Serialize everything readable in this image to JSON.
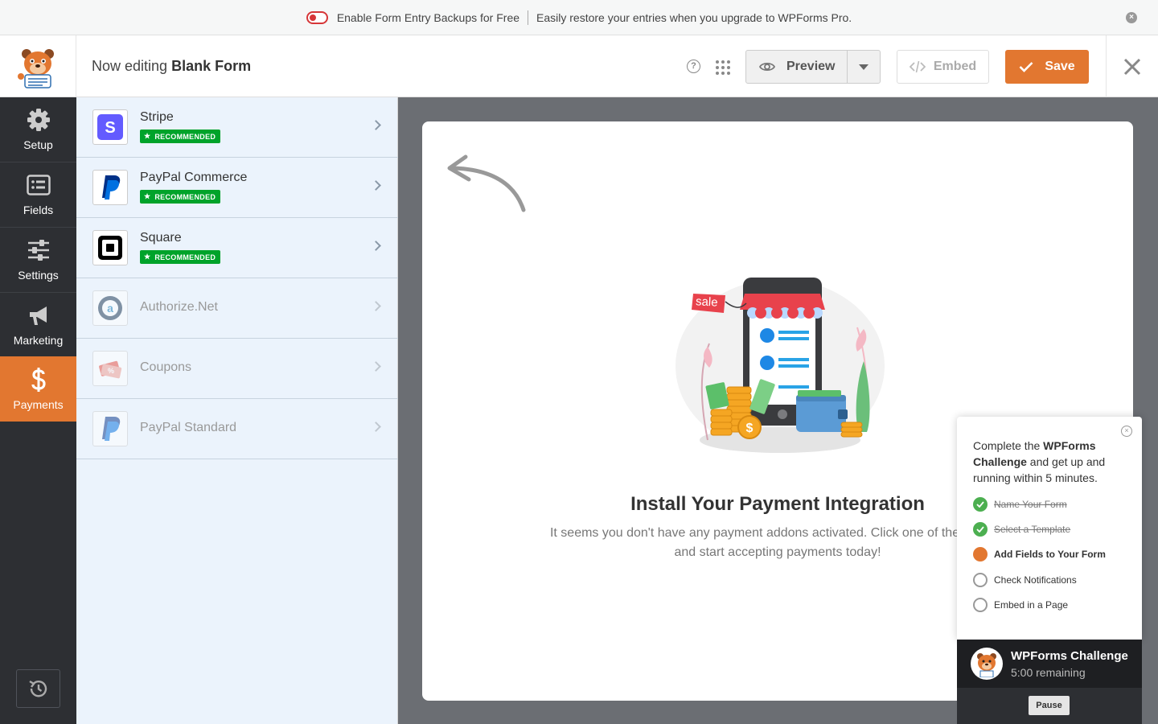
{
  "notice": {
    "toggle_label": "Enable Form Entry Backups for Free",
    "message": "Easily restore your entries when you upgrade to WPForms Pro."
  },
  "toolbar": {
    "editing_prefix": "Now editing",
    "form_name": "Blank Form",
    "help_glyph": "?",
    "preview_label": "Preview",
    "embed_label": "Embed",
    "save_label": "Save"
  },
  "sidebar": {
    "items": [
      {
        "label": "Setup",
        "icon": "gear-icon"
      },
      {
        "label": "Fields",
        "icon": "list-icon"
      },
      {
        "label": "Settings",
        "icon": "sliders-icon"
      },
      {
        "label": "Marketing",
        "icon": "megaphone-icon"
      },
      {
        "label": "Payments",
        "icon": "dollar-icon",
        "active": true
      }
    ],
    "revisions_icon": "history-icon"
  },
  "payments": {
    "items": [
      {
        "name": "Stripe",
        "badge": "RECOMMENDED",
        "enabled": true
      },
      {
        "name": "PayPal Commerce",
        "badge": "RECOMMENDED",
        "enabled": true
      },
      {
        "name": "Square",
        "badge": "RECOMMENDED",
        "enabled": true
      },
      {
        "name": "Authorize.Net",
        "enabled": false
      },
      {
        "name": "Coupons",
        "enabled": false
      },
      {
        "name": "PayPal Standard",
        "enabled": false
      }
    ]
  },
  "main": {
    "illustration_sale_text": "sale",
    "title": "Install Your Payment Integration",
    "description": "It seems you don't have any payment addons activated. Click one of the addons and start accepting payments today!"
  },
  "challenge": {
    "intro_pre": "Complete the ",
    "intro_bold": "WPForms Challenge",
    "intro_post": " and get up and running within 5 minutes.",
    "steps": [
      {
        "label": "Name Your Form",
        "state": "done"
      },
      {
        "label": "Select a Template",
        "state": "done"
      },
      {
        "label": "Add Fields to Your Form",
        "state": "current"
      },
      {
        "label": "Check Notifications",
        "state": "todo"
      },
      {
        "label": "Embed in a Page",
        "state": "todo"
      }
    ],
    "title": "WPForms Challenge",
    "remaining": "5:00 remaining",
    "pause_label": "Pause"
  },
  "colors": {
    "accent": "#e27730",
    "sidebar": "#2d2f33",
    "recommended": "#00a32a",
    "panel": "#ebf3fc"
  }
}
